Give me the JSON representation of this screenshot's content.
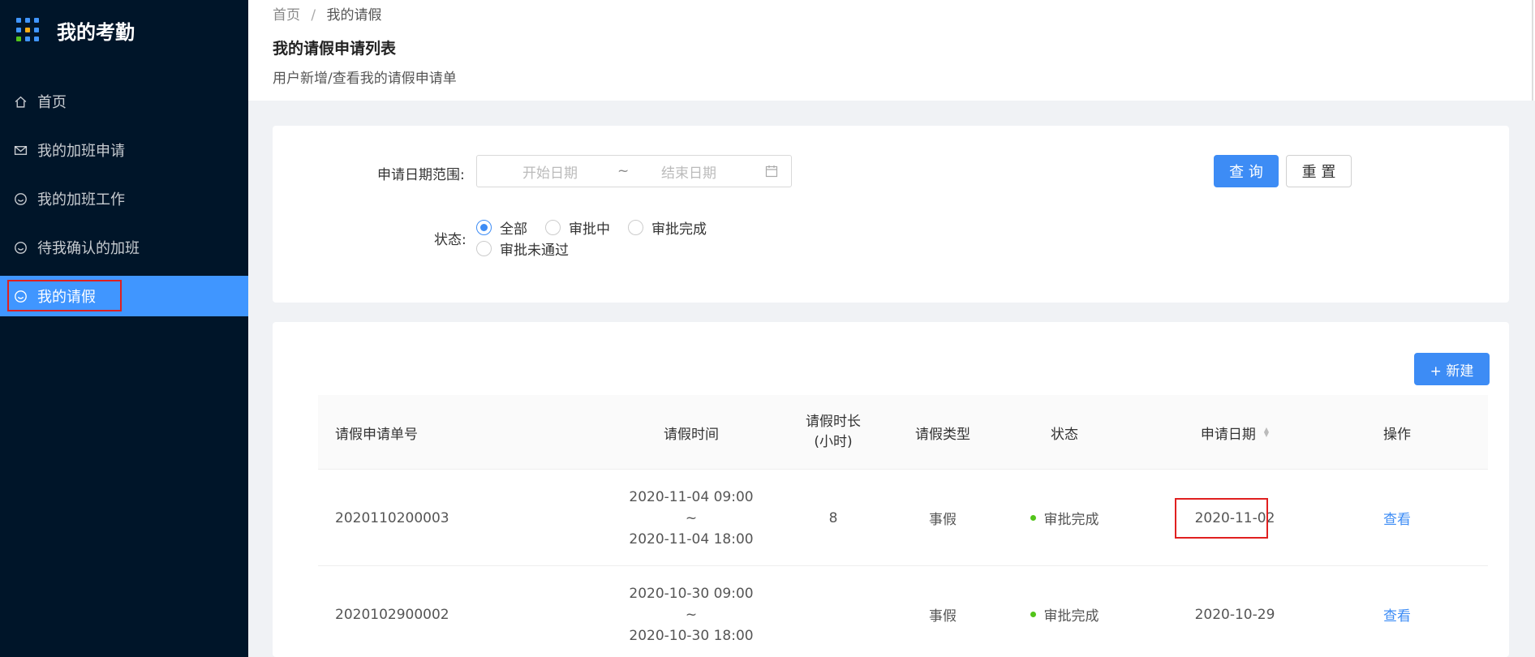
{
  "app": {
    "title": "我的考勤",
    "logo_colors": [
      "#4096ff",
      "#4096ff",
      "#4096ff",
      "#4096ff",
      "#faad14",
      "#4096ff",
      "#52c41a",
      "#4096ff",
      "#4096ff"
    ]
  },
  "sidebar": {
    "items": [
      {
        "label": "首页",
        "icon": "home-icon"
      },
      {
        "label": "我的加班申请",
        "icon": "mail-icon"
      },
      {
        "label": "我的加班工作",
        "icon": "smile-icon"
      },
      {
        "label": "待我确认的加班",
        "icon": "smile-icon"
      },
      {
        "label": "我的请假",
        "icon": "smile-icon",
        "active": true
      }
    ]
  },
  "breadcrumb": {
    "home": "首页",
    "sep": "/",
    "current": "我的请假"
  },
  "page": {
    "title": "我的请假申请列表",
    "description": "用户新增/查看我的请假申请单"
  },
  "filter": {
    "date_label": "申请日期范围:",
    "start_placeholder": "开始日期",
    "tilde": "~",
    "end_placeholder": "结束日期",
    "status_label": "状态:",
    "status_options": [
      "全部",
      "审批中",
      "审批完成",
      "审批未通过"
    ],
    "selected_status": "全部",
    "query_button": "查 询",
    "reset_button": "重 置"
  },
  "table": {
    "new_button": "+ 新建",
    "columns": [
      "请假申请单号",
      "请假时间",
      "请假时长(小时)",
      "请假类型",
      "状态",
      "申请日期",
      "操作"
    ],
    "rows": [
      {
        "id": "2020110200003",
        "start": "2020-11-04 09:00",
        "sep": "~",
        "end": "2020-11-04 18:00",
        "hours": "8",
        "type": "事假",
        "status": "审批完成",
        "date": "2020-11-02",
        "action": "查看"
      },
      {
        "id": "2020102900002",
        "start": "2020-10-30 09:00",
        "sep": "~",
        "end": "2020-10-30 18:00",
        "hours": "",
        "type": "事假",
        "status": "审批完成",
        "date": "2020-10-29",
        "action": "查看"
      }
    ]
  },
  "colors": {
    "sidebar_bg": "#001529",
    "accent": "#3d8cf5",
    "highlight_outline": "#e02020",
    "status_ok": "#52c41a"
  }
}
